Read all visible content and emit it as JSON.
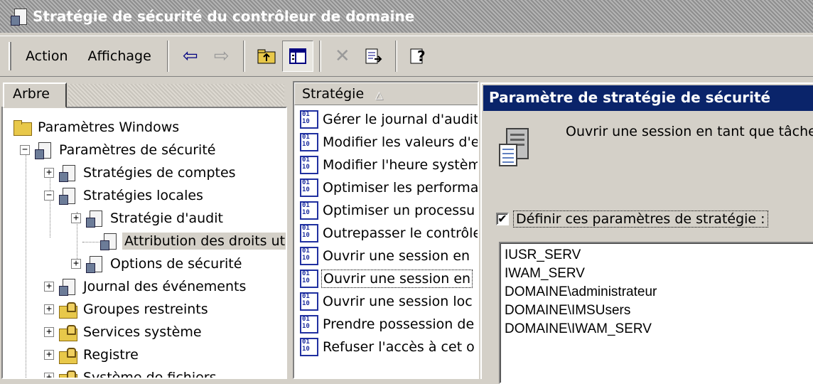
{
  "window": {
    "title": "Stratégie de sécurité du contrôleur de domaine"
  },
  "toolbar": {
    "menus": [
      "Action",
      "Affichage"
    ],
    "buttons": [
      "back-icon",
      "forward-icon",
      "up-folder-icon",
      "show-tree-icon",
      "delete-icon",
      "export-icon",
      "help-icon"
    ]
  },
  "tree": {
    "tab_label": "Arbre",
    "nodes": [
      {
        "label": "Paramètres Windows",
        "icon": "folder-icon",
        "expander": ""
      },
      {
        "label": "Paramètres de sécurité",
        "icon": "security-settings-icon",
        "expander": "−"
      },
      {
        "label": "Stratégies de comptes",
        "icon": "policy-icon",
        "expander": "+"
      },
      {
        "label": "Stratégies locales",
        "icon": "policy-icon",
        "expander": "−"
      },
      {
        "label": "Stratégie d'audit",
        "icon": "policy-icon",
        "expander": "+"
      },
      {
        "label": "Attribution des droits utilis",
        "icon": "policy-icon",
        "expander": ""
      },
      {
        "label": "Options de sécurité",
        "icon": "policy-icon",
        "expander": "+"
      },
      {
        "label": "Journal des événements",
        "icon": "policy-icon",
        "expander": "+"
      },
      {
        "label": "Groupes restreints",
        "icon": "locked-folder-icon",
        "expander": "+"
      },
      {
        "label": "Services système",
        "icon": "locked-folder-icon",
        "expander": "+"
      },
      {
        "label": "Registre",
        "icon": "locked-folder-icon",
        "expander": "+"
      },
      {
        "label": "Système de fichiers",
        "icon": "locked-folder-icon",
        "expander": "+"
      }
    ]
  },
  "list": {
    "column_header": "Stratégie",
    "sort_indicator": "△",
    "rows": [
      "Gérer le journal d'audit",
      "Modifier les valeurs d'e",
      "Modifier l'heure systèm",
      "Optimiser les performan",
      "Optimiser un processu",
      "Outrepasser le contrôle",
      "Ouvrir une session en",
      "Ouvrir une session en",
      "Ouvrir une session loc",
      "Prendre possession de",
      "Refuser l'accès à cet o"
    ]
  },
  "dialog": {
    "title": "Paramètre de stratégie de sécurité",
    "policy_name": "Ouvrir une session en tant que tâche",
    "checkbox_label": "Définir ces paramètres de stratégie :",
    "checkbox_checked": "✔",
    "users": [
      "IUSR_SERV",
      "IWAM_SERV",
      "DOMAINE\\administrateur",
      "DOMAINE\\IMSUsers",
      "DOMAINE\\IWAM_SERV"
    ]
  }
}
